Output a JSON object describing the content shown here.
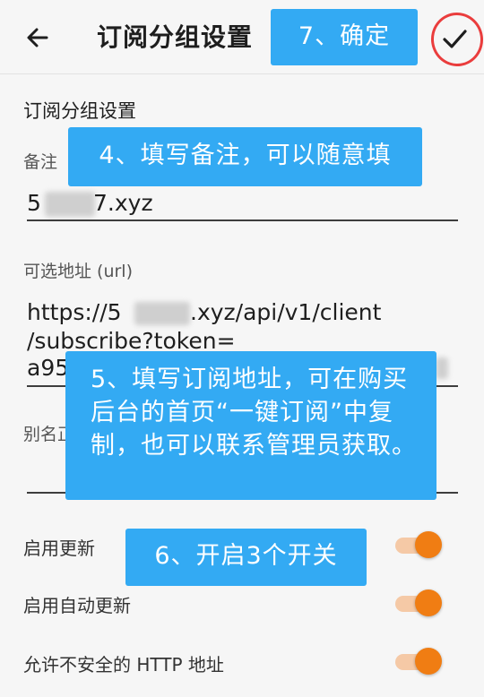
{
  "appbar": {
    "title": "订阅分组设置",
    "back_icon": "arrow-left-icon",
    "confirm_icon": "check-icon"
  },
  "form": {
    "section_title": "订阅分组设置",
    "remark_label": "备注",
    "remark_value_start": "5",
    "remark_value_end": "7.xyz",
    "url_label": "可选地址 (url)",
    "url_line1_start": "https://5",
    "url_line1_end": ".xyz/api/v1/client",
    "url_line2": "/subscribe?token=",
    "url_line3": "a95",
    "alias_label": "别名正则"
  },
  "switches": [
    {
      "label": "启用更新",
      "on": true
    },
    {
      "label": "启用自动更新",
      "on": true
    },
    {
      "label": "允许不安全的 HTTP 地址",
      "on": true
    }
  ],
  "annotations": {
    "step7": "7、确定",
    "step4": "4、填写备注，可以随意填",
    "step5": "5、填写订阅地址，可在购买后台的首页“一键订阅”中复制，也可以联系管理员获取。",
    "step6": "6、开启3个开关"
  },
  "colors": {
    "accent": "#f07d13",
    "callout": "#33aaf3",
    "highlight_circle": "#ea3d3d"
  }
}
